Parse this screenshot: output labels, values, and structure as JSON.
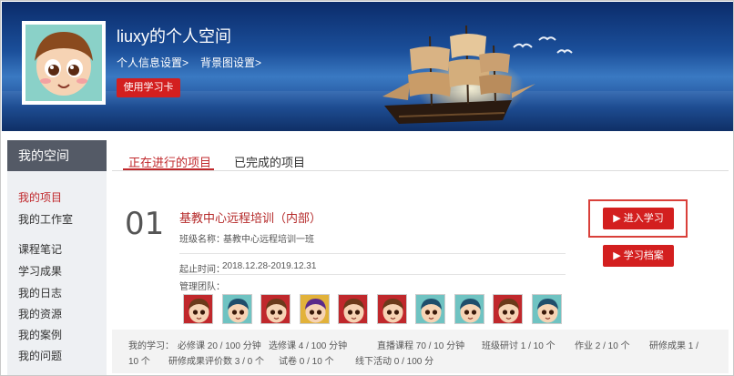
{
  "header": {
    "username": "liuxy的个人空间",
    "links": [
      "个人信息设置>",
      "背景图设置>"
    ],
    "study_card_button": "使用学习卡",
    "accent": "#d31f1f"
  },
  "sidebar": {
    "title": "我的空间",
    "items": [
      {
        "label": "我的项目",
        "active": true
      },
      {
        "label": "我的工作室"
      },
      {
        "label": "课程笔记"
      },
      {
        "label": "学习成果"
      },
      {
        "label": "我的日志"
      },
      {
        "label": "我的资源"
      },
      {
        "label": "我的案例"
      },
      {
        "label": "我的问题"
      }
    ]
  },
  "tabs": [
    {
      "label": "正在进行的项目",
      "active": true
    },
    {
      "label": "已完成的项目"
    }
  ],
  "project": {
    "number": "01",
    "title": "基教中心远程培训（内部）",
    "class_label": "班级名称：",
    "class_value": "基教中心远程培训一班",
    "period_label": "起止时间：",
    "period_value": "2018.12.28-2019.12.31",
    "team_label": "管理团队：",
    "team_icons": [
      "boy-avatar-icon",
      "girl-avatar-icon",
      "boy-avatar-icon",
      "purple-avatar-icon",
      "boy-avatar-icon",
      "boy-avatar-icon",
      "girl-avatar-icon",
      "girl-avatar-icon",
      "boy-avatar-icon",
      "girl-avatar-icon"
    ],
    "enter_button": "进入学习",
    "archive_button": "学习档案"
  },
  "stats": {
    "row1": [
      "我的学习：",
      "必修课 20 / 100 分钟",
      "选修课 4 / 100 分钟",
      "直播课程 70 / 10 分钟",
      "班级研讨 1 / 10 个",
      "作业 2 / 10 个",
      "研修成果 1 /"
    ],
    "row2": [
      "10 个",
      "研修成果评价数 3 / 0 个",
      "试卷 0 / 10 个",
      "线下活动 0 / 100 分"
    ]
  }
}
